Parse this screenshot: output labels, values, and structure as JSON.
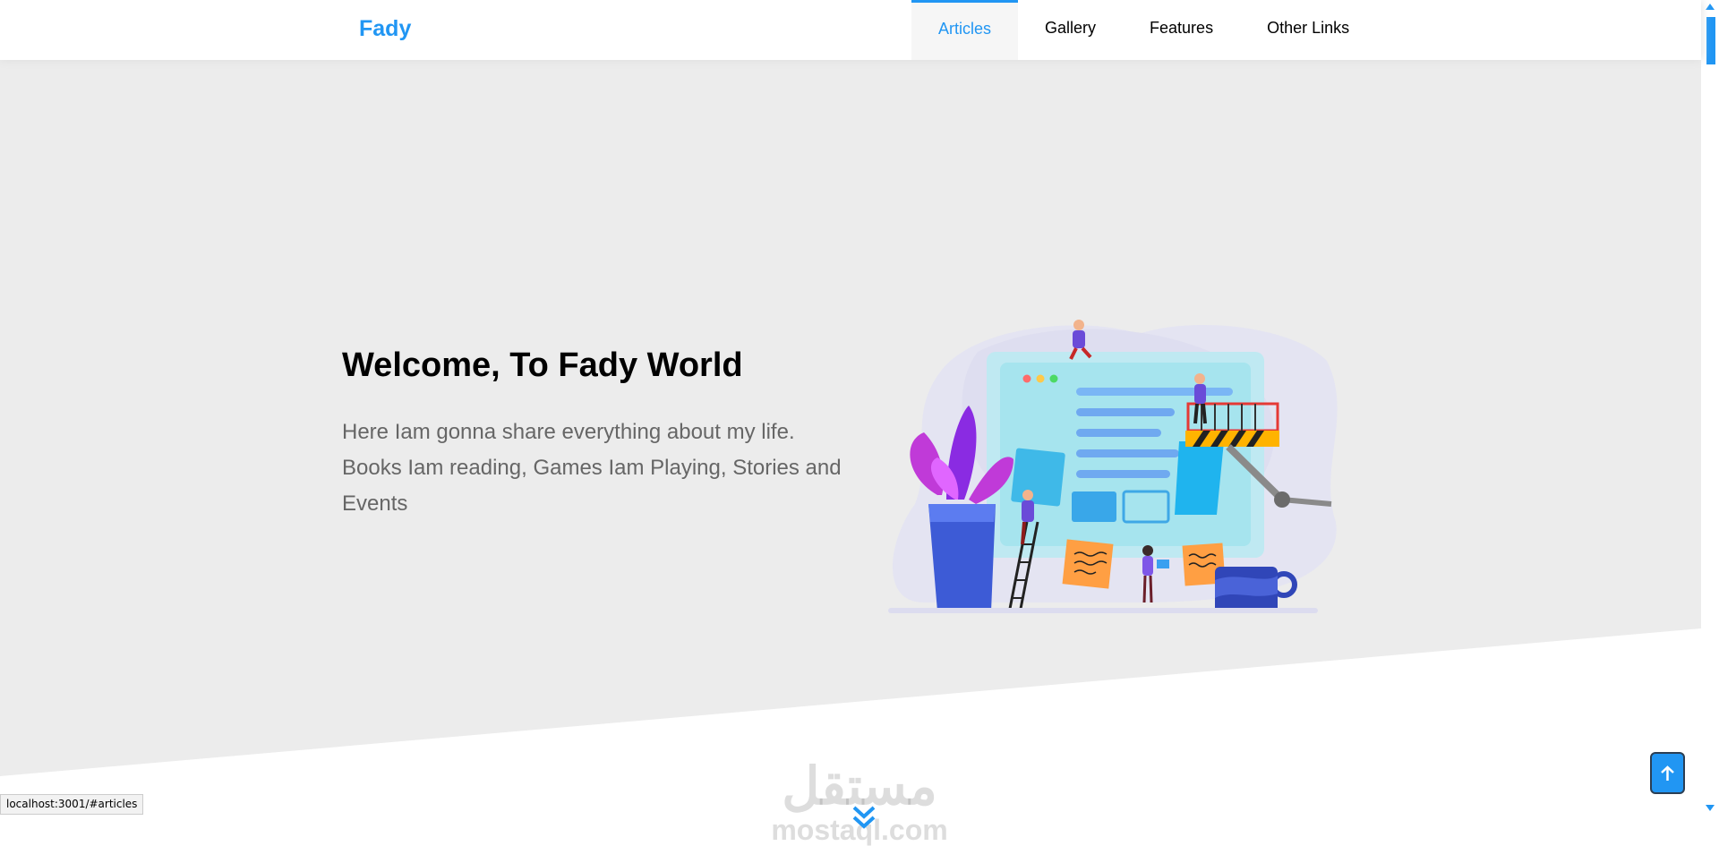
{
  "header": {
    "logo": "Fady",
    "nav": [
      {
        "label": "Articles",
        "active": true
      },
      {
        "label": "Gallery",
        "active": false
      },
      {
        "label": "Features",
        "active": false
      },
      {
        "label": "Other Links",
        "active": false
      }
    ]
  },
  "landing": {
    "title": "Welcome, To Fady World",
    "description": "Here Iam gonna share everything about my life. Books Iam reading, Games Iam Playing, Stories and Events",
    "illustration_icon": "webpage-construction-illustration"
  },
  "watermark": {
    "arabic": "مستقل",
    "latin": "mostaql.com"
  },
  "status_bar": {
    "url": "localhost:3001/#articles"
  },
  "colors": {
    "accent": "#2196f3",
    "landing_bg": "#ececec",
    "text_gray": "#666666"
  }
}
